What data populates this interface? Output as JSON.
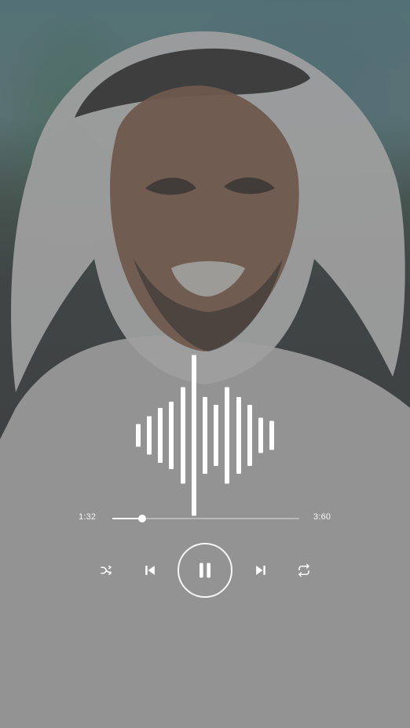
{
  "player": {
    "current_time": "1:32",
    "total_time": "3:60",
    "progress": 0.158,
    "state": "playing"
  },
  "controls": {
    "shuffle_icon": "shuffle-icon",
    "previous_icon": "skip-previous-icon",
    "pause_icon": "pause-icon",
    "next_icon": "skip-next-icon",
    "repeat_icon": "repeat-icon"
  },
  "visualizer": {
    "levels": [
      0.14,
      0.24,
      0.34,
      0.42,
      0.6,
      1.0,
      0.48,
      0.38,
      0.6,
      0.48,
      0.38,
      0.22,
      0.18
    ]
  },
  "colors": {
    "foreground": "#ffffff",
    "scrim": "#5a5a5a"
  }
}
